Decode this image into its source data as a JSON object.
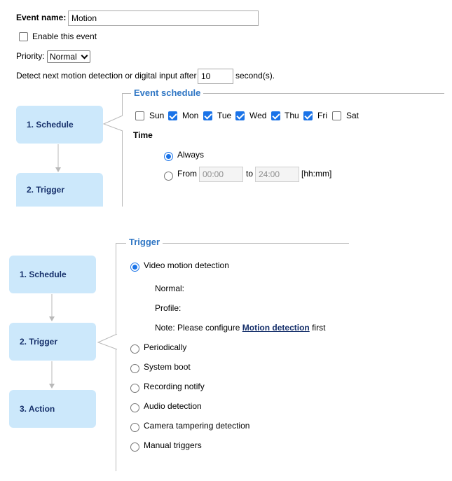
{
  "event_name": {
    "label": "Event name:",
    "value": "Motion"
  },
  "enable_event": {
    "label": "Enable this event",
    "checked": false
  },
  "priority": {
    "label": "Priority:",
    "selected": "Normal"
  },
  "detect_next": {
    "label": "Detect next motion detection or digital input after",
    "value": "10",
    "suffix": "second(s)."
  },
  "steps": {
    "schedule": "1.  Schedule",
    "trigger": "2.  Trigger",
    "action": "3.  Action"
  },
  "event_schedule": {
    "legend": "Event schedule",
    "days": [
      {
        "label": "Sun",
        "checked": false
      },
      {
        "label": "Mon",
        "checked": true
      },
      {
        "label": "Tue",
        "checked": true
      },
      {
        "label": "Wed",
        "checked": true
      },
      {
        "label": "Thu",
        "checked": true
      },
      {
        "label": "Fri",
        "checked": true
      },
      {
        "label": "Sat",
        "checked": false
      }
    ],
    "time_label": "Time",
    "always_label": "Always",
    "from_label": "From",
    "from_value": "00:00",
    "to_label": "to",
    "to_value": "24:00",
    "format_hint": "[hh:mm]"
  },
  "trigger": {
    "legend": "Trigger",
    "video_motion": "Video motion detection",
    "normal_label": "Normal:",
    "profile_label": "Profile:",
    "note_prefix": "Note: Please configure",
    "note_link": "Motion detection",
    "note_suffix": "first",
    "options": [
      "Periodically",
      "System boot",
      "Recording notify",
      "Audio detection",
      "Camera tampering detection",
      "Manual triggers"
    ]
  },
  "colors": {
    "accent": "#1a73e8",
    "step_bg": "#cce8fb",
    "step_text": "#16306b",
    "legend": "#2f76c4"
  }
}
